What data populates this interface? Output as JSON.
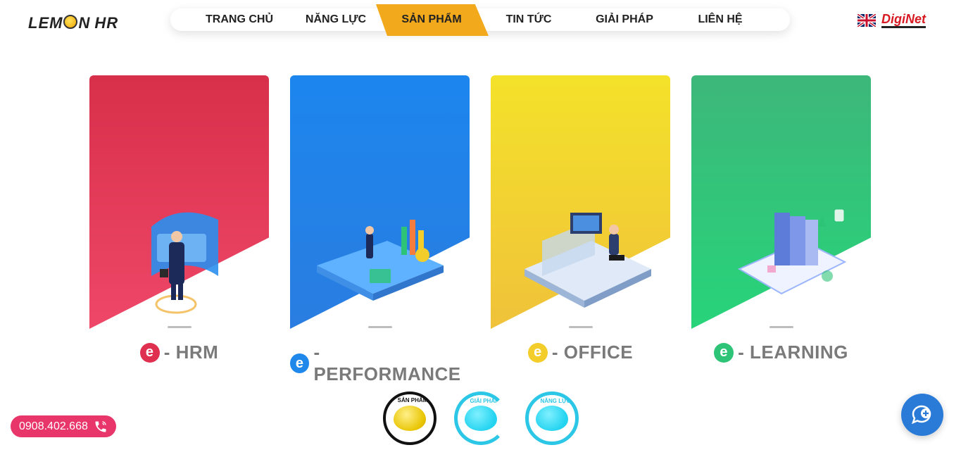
{
  "brand": {
    "logo_left": "LEM",
    "logo_mid": "N",
    "logo_right": "HR",
    "right_logo": "DigiNet"
  },
  "nav": {
    "items": [
      {
        "label": "TRANG CHỦ"
      },
      {
        "label": "NĂNG LỰC"
      },
      {
        "label": "SẢN PHẨM",
        "active": true
      },
      {
        "label": "TIN TỨC"
      },
      {
        "label": "GIẢI PHÁP"
      },
      {
        "label": "LIÊN HỆ"
      }
    ],
    "active_color": "#f2a91b"
  },
  "cards": [
    {
      "badge": "e",
      "title": "- HRM",
      "color": "#e0304f"
    },
    {
      "badge": "e",
      "title": "- PERFORMANCE",
      "color": "#1f88ea"
    },
    {
      "badge": "e",
      "title": "- OFFICE",
      "color": "#f3cd2a"
    },
    {
      "badge": "e",
      "title": "- LEARNING",
      "color": "#2ec477"
    }
  ],
  "lemons": [
    {
      "label": "SẢN PHẨM",
      "active": true
    },
    {
      "label": "GIẢI PHÁP",
      "active": false
    },
    {
      "label": "NĂNG LỰC",
      "active": false
    }
  ],
  "contact": {
    "phone": "0908.402.668"
  },
  "icons": {
    "phone": "phone-icon",
    "chat": "chat-plus-icon",
    "flag": "uk-flag-icon"
  }
}
